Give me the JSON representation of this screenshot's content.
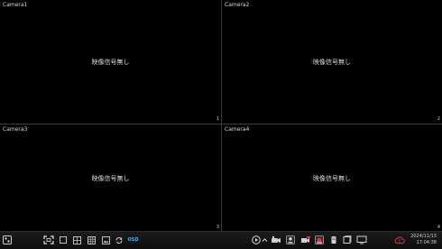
{
  "cameras": [
    {
      "label": "Camera1",
      "status": "映像信号無し",
      "index": "1"
    },
    {
      "label": "Camera2",
      "status": "映像信号無し",
      "index": "2"
    },
    {
      "label": "Camera3",
      "status": "映像信号無し",
      "index": "3"
    },
    {
      "label": "Camera4",
      "status": "映像信号無し",
      "index": "4"
    }
  ],
  "taskbar": {
    "osd_label": "OSD",
    "date": "2024/11/13",
    "time": "17:04:38"
  },
  "colors": {
    "accent": "#4fb3e8",
    "record_red": "#e0323a"
  }
}
